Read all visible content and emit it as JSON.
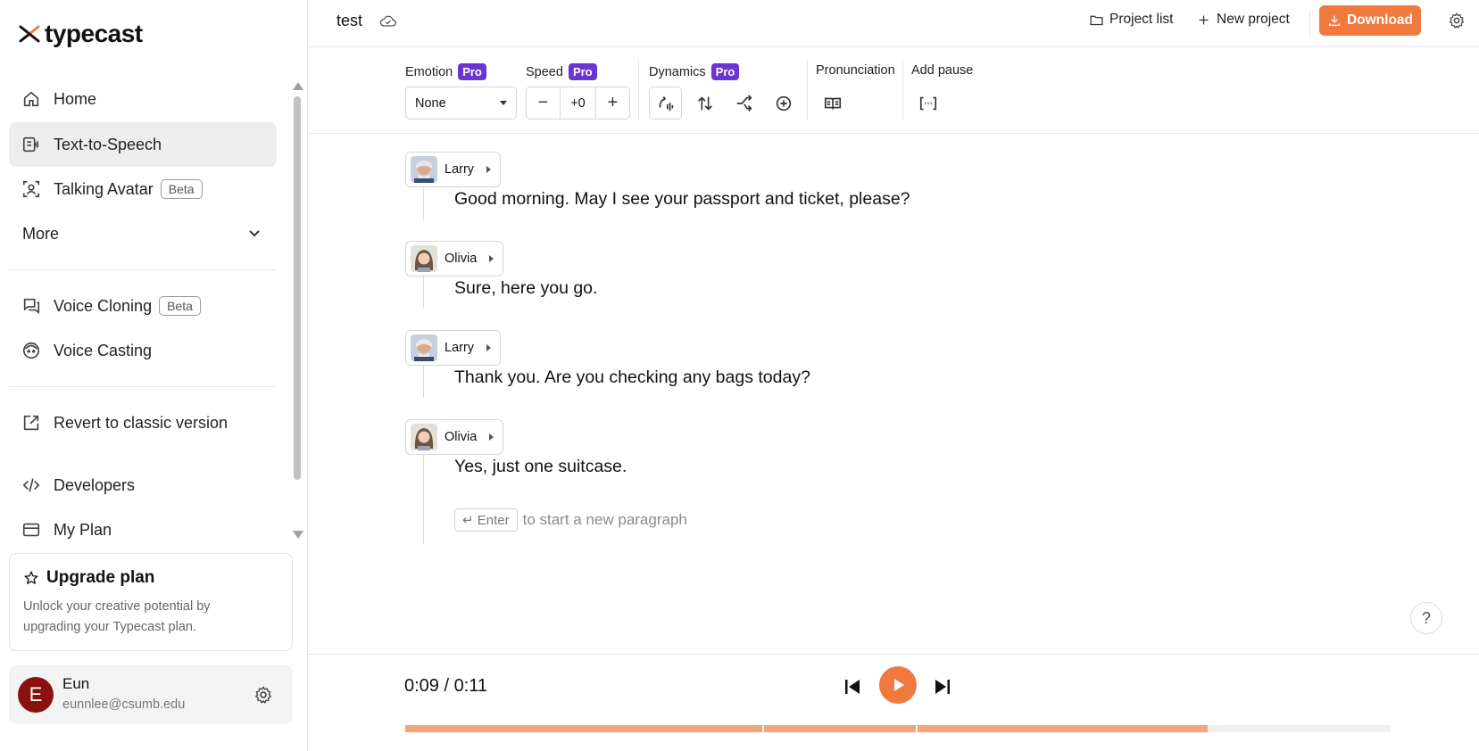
{
  "app": {
    "logo_text": "typecast"
  },
  "sidebar": {
    "items": [
      {
        "label": "Home",
        "icon": "home-icon"
      },
      {
        "label": "Text-to-Speech",
        "icon": "tts-icon",
        "active": true
      },
      {
        "label": "Talking Avatar",
        "icon": "avatar-icon",
        "badge": "Beta"
      },
      {
        "label": "More",
        "icon": "chevron-down-icon"
      },
      {
        "label": "Voice Cloning",
        "icon": "voice-cloning-icon",
        "badge": "Beta"
      },
      {
        "label": "Voice Casting",
        "icon": "voice-casting-icon"
      },
      {
        "label": "Revert to classic version",
        "icon": "external-link-icon"
      },
      {
        "label": "Developers",
        "icon": "code-icon"
      },
      {
        "label": "My Plan",
        "icon": "credit-card-icon"
      }
    ],
    "upgrade": {
      "title": "Upgrade plan",
      "description": "Unlock your creative potential by upgrading your Typecast plan."
    },
    "user": {
      "initial": "E",
      "name": "Eun",
      "email": "eunnlee@csumb.edu"
    }
  },
  "topbar": {
    "project_title": "test",
    "project_list": "Project list",
    "new_project": "New project",
    "download": "Download"
  },
  "toolbar": {
    "emotion_label": "Emotion",
    "speed_label": "Speed",
    "dynamics_label": "Dynamics",
    "pronunciation_label": "Pronunciation",
    "add_pause_label": "Add pause",
    "pro_badge": "Pro",
    "emotion_value": "None",
    "speed_value": "+0",
    "speed_minus": "−",
    "speed_plus": "+"
  },
  "paragraphs": [
    {
      "speaker": "Larry",
      "text": "Good morning. May I see your passport and ticket, please?"
    },
    {
      "speaker": "Olivia",
      "text": "Sure, here you go."
    },
    {
      "speaker": "Larry",
      "text": "Thank you. Are you checking any bags today?"
    },
    {
      "speaker": "Olivia",
      "text": "Yes, just one suitcase."
    }
  ],
  "editor": {
    "enter_key": "↵ Enter",
    "enter_hint": "to start a new paragraph",
    "help": "?"
  },
  "player": {
    "time": "0:09 / 0:11",
    "segments": [
      0.364,
      0.156,
      0.296
    ],
    "colors": {
      "accent": "#f07a3e",
      "segment": "#f3a57a",
      "track": "#efefef"
    }
  },
  "colors": {
    "pro_badge": "#6a35d2",
    "download": "#f07a3e",
    "avatar_bg": "#8b1010"
  }
}
